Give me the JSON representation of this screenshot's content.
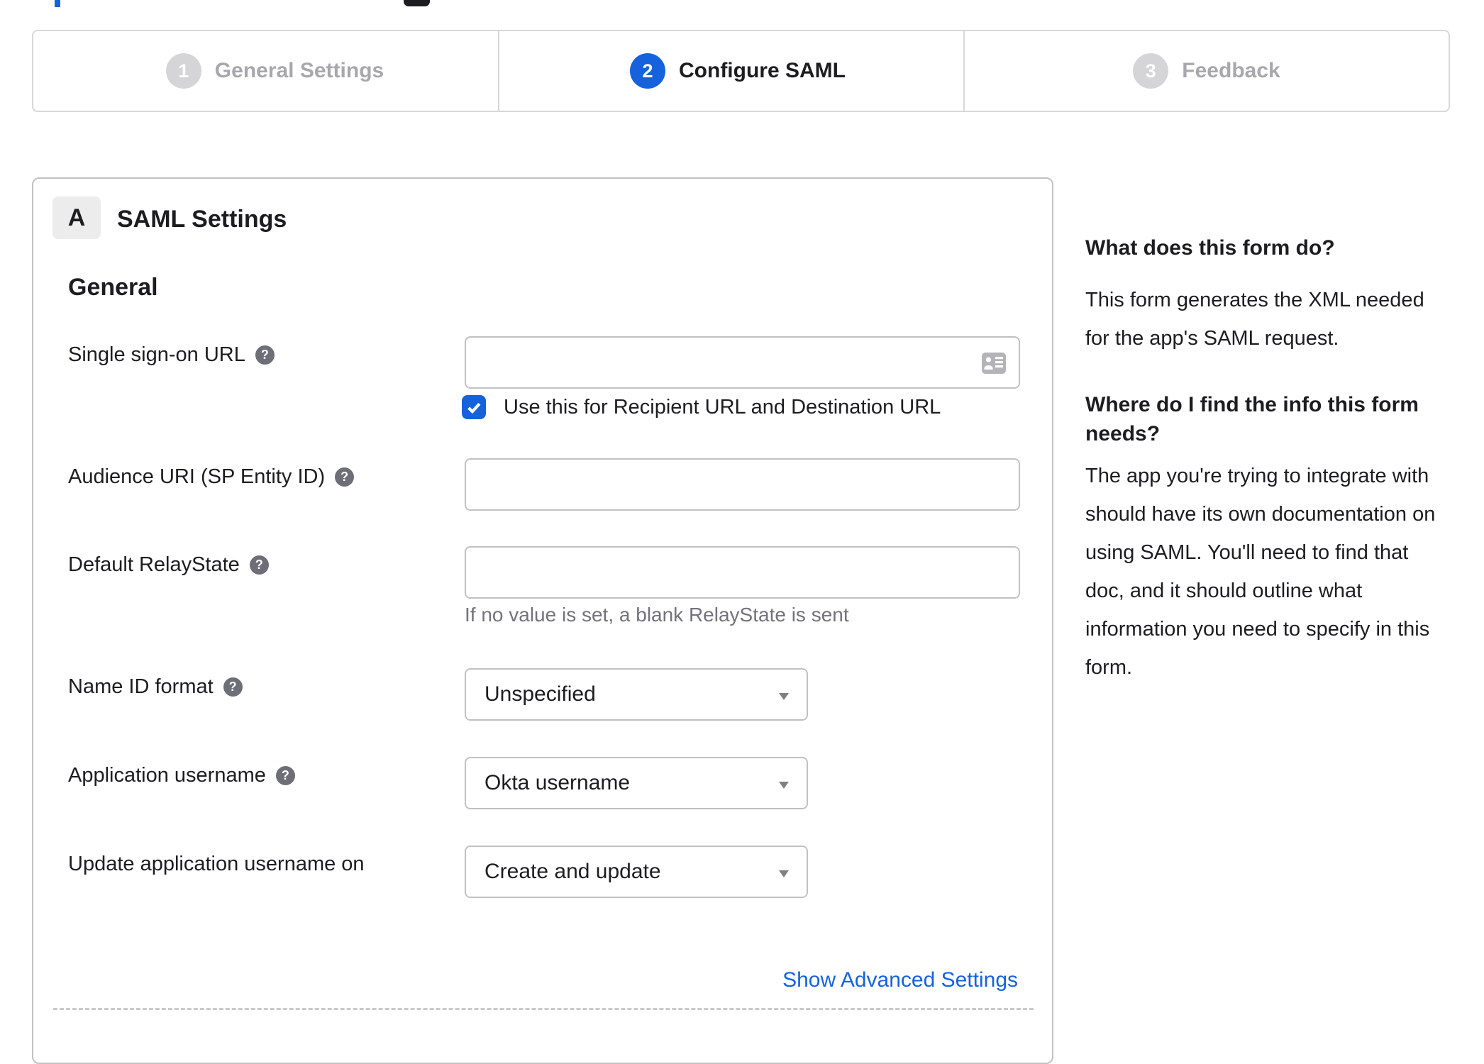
{
  "top_fragments": {
    "blue_fragment": "",
    "dark_fragment": ""
  },
  "stepper": {
    "steps": [
      {
        "num": "1",
        "label": "General Settings",
        "active": false
      },
      {
        "num": "2",
        "label": "Configure SAML",
        "active": true
      },
      {
        "num": "3",
        "label": "Feedback",
        "active": false
      }
    ]
  },
  "panel": {
    "section_badge": "A",
    "section_title": "SAML Settings",
    "group_heading": "General",
    "fields": {
      "sso": {
        "label": "Single sign-on URL",
        "value": "",
        "checkbox_label": "Use this for Recipient URL and Destination URL",
        "checkbox_checked": true
      },
      "audience": {
        "label": "Audience URI (SP Entity ID)",
        "value": ""
      },
      "relay": {
        "label": "Default RelayState",
        "value": "",
        "hint": "If no value is set, a blank RelayState is sent"
      },
      "nameid": {
        "label": "Name ID format",
        "value": "Unspecified"
      },
      "appuser": {
        "label": "Application username",
        "value": "Okta username"
      },
      "updateuser": {
        "label": "Update application username on",
        "value": "Create and update"
      }
    },
    "advanced_link": "Show Advanced Settings"
  },
  "sidebar": {
    "h1": "What does this form do?",
    "p1": [
      "This form generates the XML needed",
      "for the app's SAML request."
    ],
    "h2": [
      "Where do I find the info this form",
      "needs?"
    ],
    "p2": [
      "The app you're trying to integrate with",
      "should have its own documentation on",
      "using SAML. You'll need to find that",
      "doc, and it should outline what",
      "information you need to specify in this",
      "form."
    ]
  }
}
